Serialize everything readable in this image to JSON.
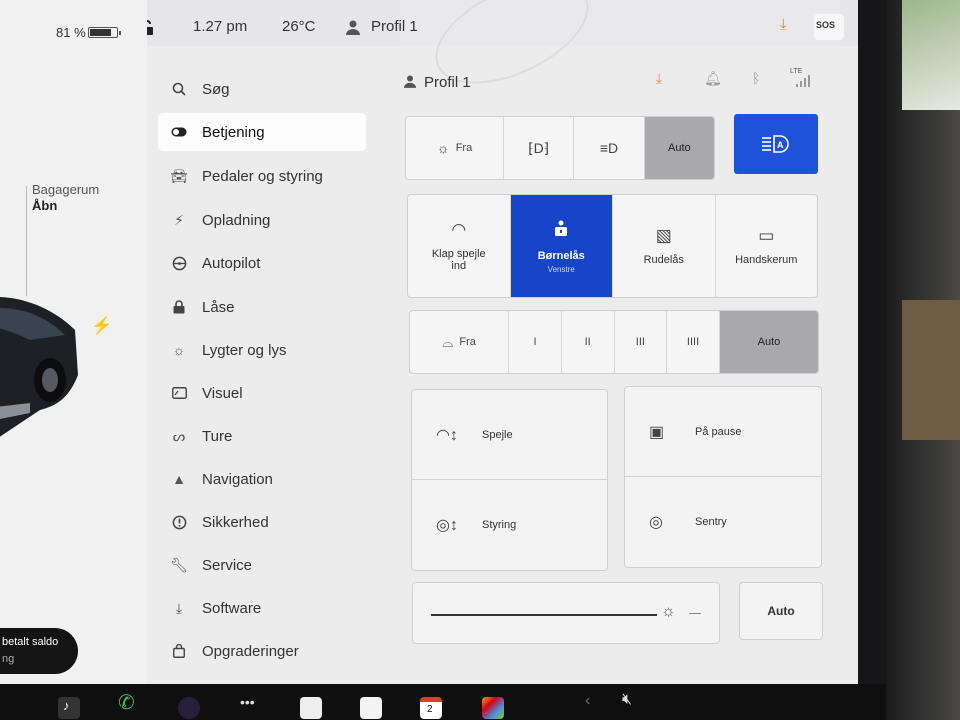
{
  "status_bar": {
    "battery_percent": "81 %",
    "battery_level": 0.81,
    "time": "1.27 pm",
    "temperature": "26°C",
    "profile_name": "Profil 1",
    "sos_label": "SOS",
    "icons": [
      "lock-open-icon",
      "person-icon",
      "download-icon",
      "sos-icon"
    ]
  },
  "vehicle": {
    "trunk_label": "Bagagerum",
    "trunk_action": "Åbn",
    "charging_icon": "bolt-icon"
  },
  "notification": {
    "title": "betalt saldo",
    "subtitle": "ng"
  },
  "menu": {
    "items": [
      {
        "label": "Søg",
        "icon": "search-icon"
      },
      {
        "label": "Betjening",
        "icon": "toggle-icon",
        "active": true
      },
      {
        "label": "Pedaler og styring",
        "icon": "car-icon"
      },
      {
        "label": "Opladning",
        "icon": "bolt-icon"
      },
      {
        "label": "Autopilot",
        "icon": "steering-wheel-icon"
      },
      {
        "label": "Låse",
        "icon": "lock-icon"
      },
      {
        "label": "Lygter og lys",
        "icon": "sun-icon"
      },
      {
        "label": "Visuel",
        "icon": "display-icon"
      },
      {
        "label": "Ture",
        "icon": "trips-icon"
      },
      {
        "label": "Navigation",
        "icon": "navigation-icon"
      },
      {
        "label": "Sikkerhed",
        "icon": "alert-circle-icon"
      },
      {
        "label": "Service",
        "icon": "wrench-icon"
      },
      {
        "label": "Software",
        "icon": "download-icon"
      },
      {
        "label": "Opgraderinger",
        "icon": "bag-icon"
      }
    ]
  },
  "controls": {
    "profile_name": "Profil 1",
    "header_icons": [
      "download-icon",
      "bell-icon",
      "bluetooth-icon",
      "lte-signal-icon"
    ],
    "lte_label": "LTE",
    "lights": {
      "options": [
        {
          "label": "Fra",
          "icon": "sun-off-icon"
        },
        {
          "label": "",
          "icon": "parking-lights-icon"
        },
        {
          "label": "",
          "icon": "low-beam-icon"
        },
        {
          "label": "Auto",
          "icon": ""
        }
      ],
      "selected": "Auto",
      "auto_high_beam_icon": "auto-high-beam-icon",
      "auto_high_beam_active": true
    },
    "tiles": [
      {
        "label": "Klap spejle ind",
        "sub": "",
        "icon": "mirror-icon"
      },
      {
        "label": "Børnelås",
        "sub": "Venstre",
        "icon": "child-lock-icon",
        "active": true
      },
      {
        "label": "Rudelås",
        "sub": "",
        "icon": "window-lock-icon"
      },
      {
        "label": "Handskerum",
        "sub": "",
        "icon": "glovebox-icon"
      }
    ],
    "wipers": {
      "options": [
        "Fra",
        "I",
        "II",
        "III",
        "IIII",
        "Auto"
      ],
      "selected": "Auto",
      "icon": "wiper-icon"
    },
    "adjust": {
      "mirrors": "Spejle",
      "steering": "Styring"
    },
    "camera": {
      "dashcam": "På pause",
      "sentry": "Sentry"
    },
    "brightness": {
      "level": 0.89,
      "auto_label": "Auto"
    }
  },
  "dock": {
    "icons": [
      "music-icon",
      "phone-icon",
      "camera-icon",
      "more-icon",
      "info-icon",
      "notes-icon",
      "calendar-icon",
      "games-icon",
      "chevron-left-icon",
      "volume-muted-icon"
    ],
    "calendar_day": "2"
  }
}
